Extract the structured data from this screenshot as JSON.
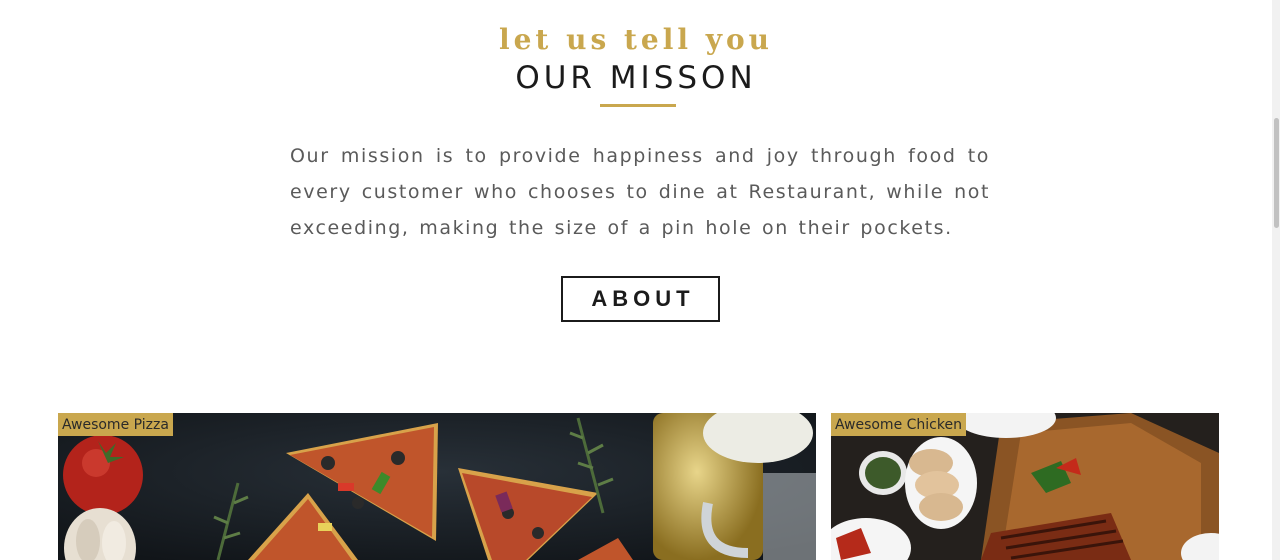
{
  "mission": {
    "eyebrow": "let us tell you",
    "title": "OUR MISSON",
    "text": "Our mission is to provide happiness and joy through food to every customer who chooses to dine at Restaurant, while not exceeding, making the size of a pin hole on their pockets.",
    "button_label": "ABOUT"
  },
  "cards": [
    {
      "tag": "Awesome Pizza"
    },
    {
      "tag": "Awesome Chicken"
    }
  ],
  "colors": {
    "accent": "#c9a74e",
    "heading": "#1b1b1b",
    "body_text": "#5a5a5a"
  }
}
